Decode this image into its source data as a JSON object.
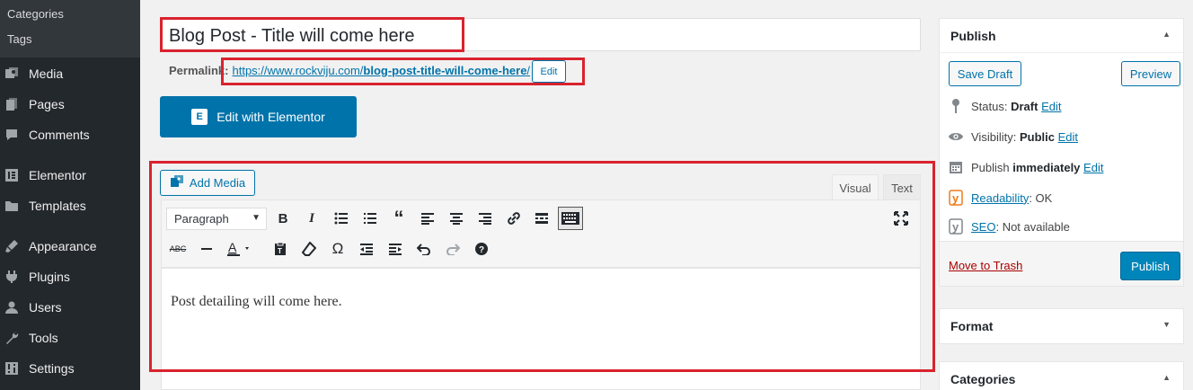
{
  "sidebar": {
    "submenu": [
      "Categories",
      "Tags"
    ],
    "items": [
      {
        "label": "Media",
        "icon": "media-icon"
      },
      {
        "label": "Pages",
        "icon": "pages-icon"
      },
      {
        "label": "Comments",
        "icon": "comments-icon"
      },
      {
        "label": "Elementor",
        "icon": "elementor-icon"
      },
      {
        "label": "Templates",
        "icon": "templates-icon"
      },
      {
        "label": "Appearance",
        "icon": "appearance-icon"
      },
      {
        "label": "Plugins",
        "icon": "plugins-icon"
      },
      {
        "label": "Users",
        "icon": "users-icon"
      },
      {
        "label": "Tools",
        "icon": "tools-icon"
      },
      {
        "label": "Settings",
        "icon": "settings-icon"
      }
    ]
  },
  "editor": {
    "title": "Blog Post - Title will come here",
    "permalink_label": "Permalink:",
    "permalink_base": "https://www.rockviju.com/",
    "permalink_slug": "blog-post-title-will-come-here",
    "permalink_trail": "/",
    "permalink_edit": "Edit",
    "elementor_label": "Edit with Elementor",
    "add_media_label": "Add Media",
    "tab_visual": "Visual",
    "tab_text": "Text",
    "format_select": "Paragraph",
    "content": "Post detailing will come here."
  },
  "publish_box": {
    "title": "Publish",
    "save_draft": "Save Draft",
    "preview": "Preview",
    "status_label": "Status:",
    "status_value": "Draft",
    "visibility_label": "Visibility:",
    "visibility_value": "Public",
    "publish_label": "Publish",
    "publish_value": "immediately",
    "readability_label": "Readability",
    "readability_value": ": OK",
    "seo_label": "SEO",
    "seo_value": ": Not available",
    "edit": "Edit",
    "trash": "Move to Trash",
    "publish_button": "Publish"
  },
  "format_box": {
    "title": "Format"
  },
  "categories_box": {
    "title": "Categories"
  },
  "colors": {
    "accent": "#0073aa",
    "highlight": "#d9232e",
    "sidebar": "#23282d"
  }
}
